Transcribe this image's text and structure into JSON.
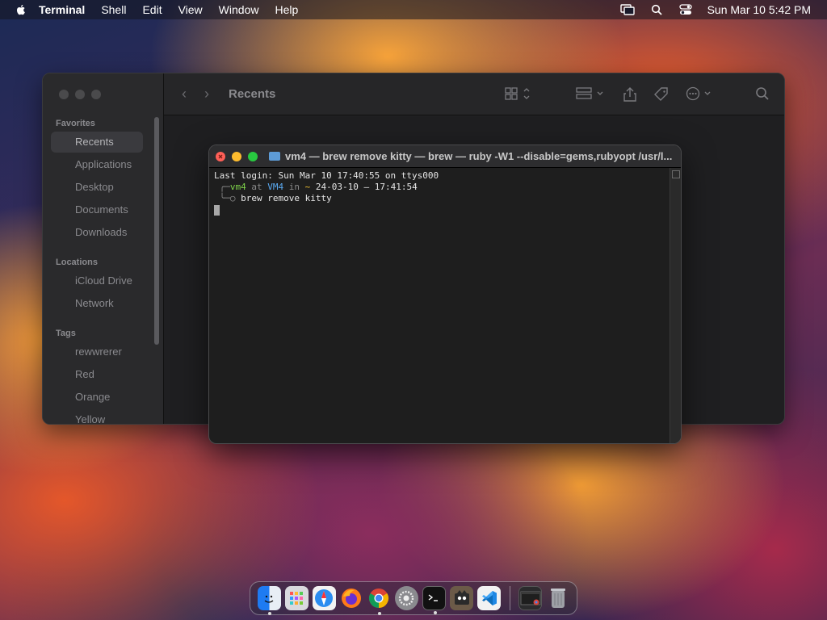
{
  "menubar": {
    "app_name": "Terminal",
    "items": [
      "Shell",
      "Edit",
      "View",
      "Window",
      "Help"
    ],
    "clock": "Sun Mar 10  5:42 PM"
  },
  "finder": {
    "title": "Recents",
    "sections": {
      "favorites": "Favorites",
      "locations": "Locations",
      "tags": "Tags"
    },
    "favorites": [
      "Recents",
      "Applications",
      "Desktop",
      "Documents",
      "Downloads"
    ],
    "locations": [
      "iCloud Drive",
      "Network"
    ],
    "tags": [
      "rewwrerer",
      "Red",
      "Orange",
      "Yellow"
    ]
  },
  "terminal": {
    "title": "vm4 — brew remove kitty — brew — ruby -W1 --disable=gems,rubyopt /usr/l...",
    "last_login": "Last login: Sun Mar 10 17:40:55 on ttys000",
    "prompt_user": "vm4",
    "prompt_at": "at",
    "prompt_host": "VM4",
    "prompt_in": "in",
    "prompt_dir": "~",
    "prompt_time": "24-03-10 – 17:41:54",
    "command": "brew remove kitty"
  },
  "dock": {
    "apps": [
      "finder",
      "launchpad",
      "safari",
      "firefox",
      "chrome",
      "system-settings",
      "terminal",
      "gimp",
      "vscode"
    ],
    "accent": "#ffffff"
  }
}
